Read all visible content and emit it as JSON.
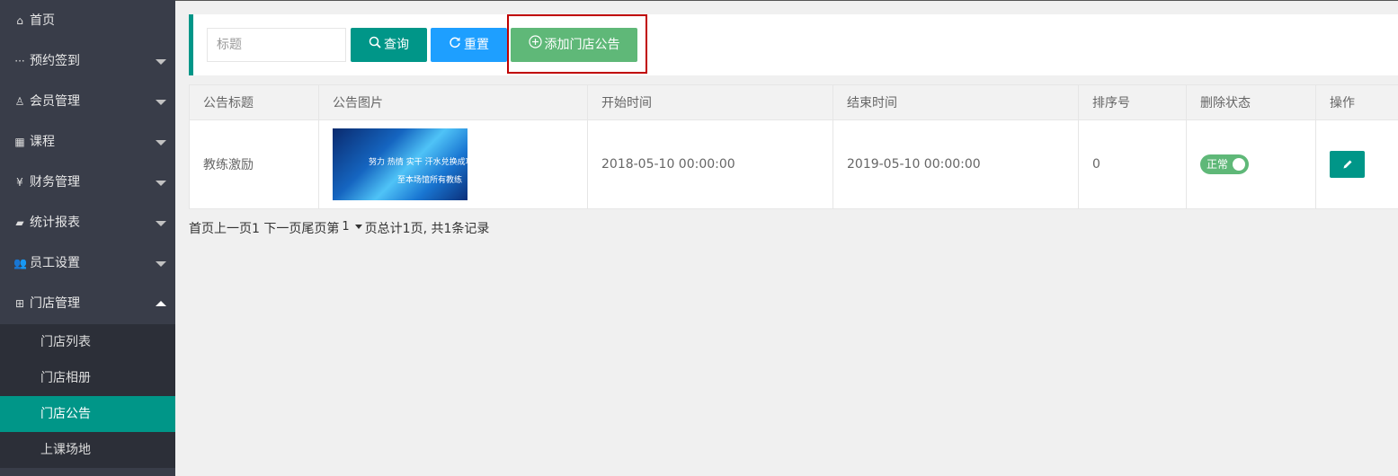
{
  "sidebar": {
    "items": [
      {
        "label": "首页",
        "icon": "home-icon",
        "glyph": "⌂",
        "caret": ""
      },
      {
        "label": "预约签到",
        "icon": "dots-icon",
        "glyph": "···",
        "caret": "down"
      },
      {
        "label": "会员管理",
        "icon": "user-icon",
        "glyph": "♙",
        "caret": "down"
      },
      {
        "label": "课程",
        "icon": "grid-icon",
        "glyph": "▦",
        "caret": "down"
      },
      {
        "label": "财务管理",
        "icon": "yen-icon",
        "glyph": "¥",
        "caret": "down"
      },
      {
        "label": "统计报表",
        "icon": "report-icon",
        "glyph": "▰",
        "caret": "down"
      },
      {
        "label": "员工设置",
        "icon": "users-icon",
        "glyph": "👥",
        "caret": "down"
      },
      {
        "label": "门店管理",
        "icon": "store-icon",
        "glyph": "⊞",
        "caret": "up"
      }
    ],
    "sub_items": [
      {
        "label": "门店列表",
        "active": false
      },
      {
        "label": "门店相册",
        "active": false
      },
      {
        "label": "门店公告",
        "active": true
      },
      {
        "label": "上课场地",
        "active": false
      }
    ]
  },
  "toolbar": {
    "search_placeholder": "标题",
    "query_label": "查询",
    "reset_label": "重置",
    "add_label": "添加门店公告"
  },
  "table": {
    "headers": [
      "公告标题",
      "公告图片",
      "开始时间",
      "结束时间",
      "排序号",
      "删除状态",
      "操作"
    ],
    "rows": [
      {
        "title": "教练激励",
        "image_text_1": "努力 热情 实干 汗水兑换成功",
        "image_text_2": "至本场馆所有教练",
        "start_time": "2018-05-10 00:00:00",
        "end_time": "2019-05-10 00:00:00",
        "sort": "0",
        "status": "正常"
      }
    ]
  },
  "pager": {
    "first": "首页",
    "prev": "上一页",
    "current": "1",
    "next": "下一页",
    "last": "尾页",
    "goto_prefix": "第",
    "page_select": "1",
    "goto_suffix": "页",
    "summary": "总计1页, 共1条记录"
  },
  "colors": {
    "sidebar_bg": "#393d49",
    "accent": "#009688",
    "blue": "#1e9fff",
    "green": "#5fb878",
    "highlight_border": "#c00000"
  }
}
